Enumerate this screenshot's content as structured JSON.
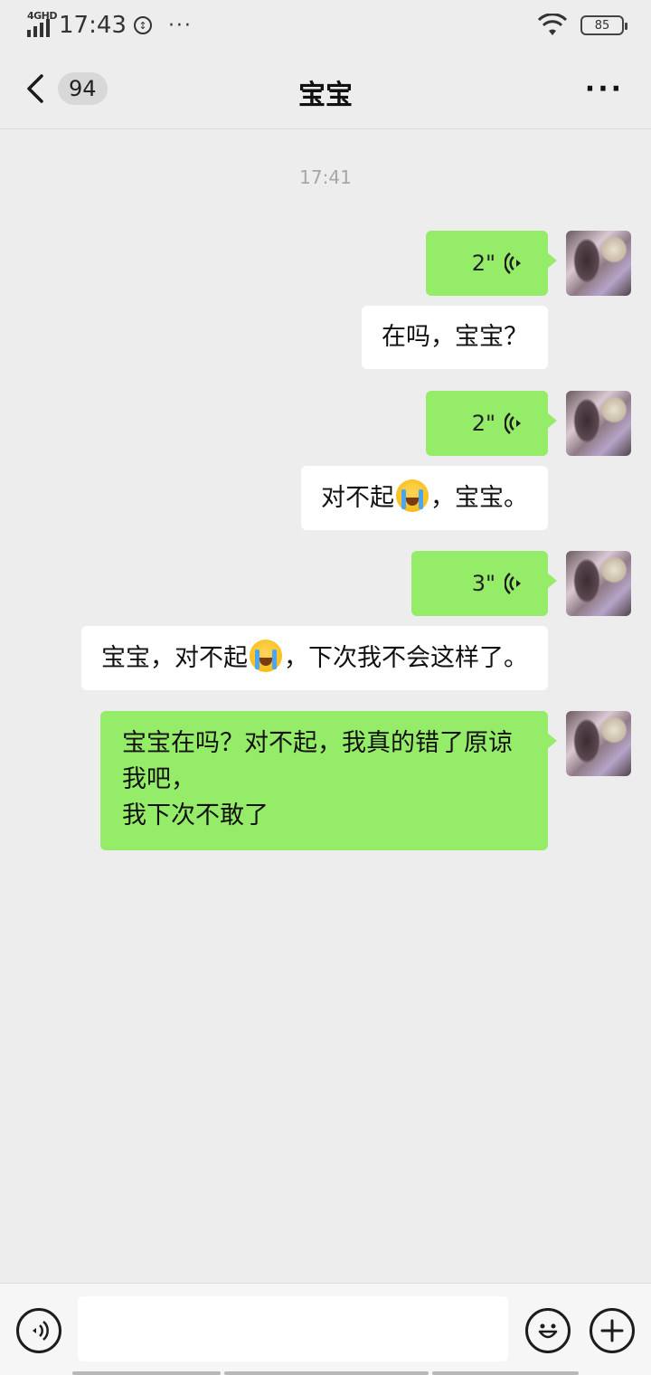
{
  "status_bar": {
    "network": "4GHD",
    "time": "17:43",
    "more": "···",
    "battery": "85"
  },
  "header": {
    "unread_count": "94",
    "title": "宝宝",
    "more": "···"
  },
  "chat": {
    "timestamp": "17:41",
    "messages": [
      {
        "type": "voice",
        "duration": "2\""
      },
      {
        "type": "text",
        "text": "在吗，宝宝？"
      },
      {
        "type": "voice",
        "duration": "2\""
      },
      {
        "type": "text",
        "parts": [
          "对不起",
          "，宝宝。"
        ]
      },
      {
        "type": "voice",
        "duration": "3\""
      },
      {
        "type": "text",
        "parts": [
          "宝宝，对不起",
          "，下次我不会这样了。"
        ]
      },
      {
        "type": "text",
        "lines": [
          "宝宝在吗？对不起，我真的错了原谅我吧，",
          "我下次不敢了"
        ]
      }
    ]
  },
  "icons": {
    "back": "chevron-left-icon",
    "voice_wave": "voice-wave-icon",
    "emoji": "loudly-crying-face-emoji",
    "voice_input": "voice-input-icon",
    "emoji_button": "smiley-icon",
    "plus": "plus-icon"
  },
  "colors": {
    "sent_bubble": "#95ec69",
    "background": "#ededed"
  }
}
